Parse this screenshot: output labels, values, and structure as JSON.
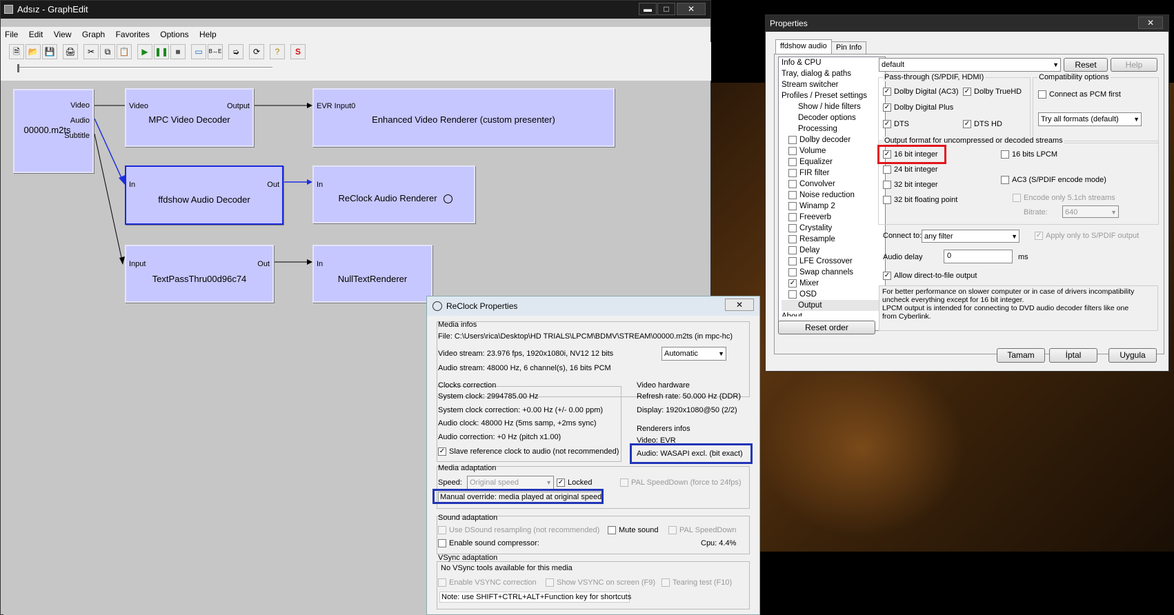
{
  "graphedit": {
    "title": "Adsız - GraphEdit",
    "menu": [
      "File",
      "Edit",
      "View",
      "Graph",
      "Favorites",
      "Options",
      "Help"
    ],
    "filters": {
      "source": {
        "name": "00000.m2ts",
        "pins": [
          "Video",
          "Audio",
          "Subtitle"
        ]
      },
      "mpc": {
        "name": "MPC Video Decoder",
        "in": "Video",
        "out": "Output"
      },
      "evr": {
        "name": "Enhanced Video Renderer (custom presenter)",
        "in": "EVR Input0"
      },
      "ffdshow": {
        "name": "ffdshow Audio Decoder",
        "in": "In",
        "out": "Out"
      },
      "reclock": {
        "name": "ReClock Audio Renderer",
        "in": "In"
      },
      "textpass": {
        "name": "TextPassThru00d96c74",
        "in": "Input",
        "out": "Out"
      },
      "nulltext": {
        "name": "NullTextRenderer",
        "in": "In"
      }
    }
  },
  "props": {
    "title": "Properties",
    "tabs": [
      "ffdshow audio",
      "Pin Info"
    ],
    "tree": [
      "Info & CPU",
      "Tray, dialog & paths",
      "Stream switcher",
      "Profiles / Preset settings",
      "Show / hide filters",
      "Decoder options",
      "Processing",
      "Dolby decoder",
      "Volume",
      "Equalizer",
      "FIR filter",
      "Convolver",
      "Noise reduction",
      "Winamp 2",
      "Freeverb",
      "Crystality",
      "Resample",
      "Delay",
      "LFE Crossover",
      "Swap channels",
      "Mixer",
      "OSD",
      "Output",
      "About"
    ],
    "preset": "default",
    "reset": "Reset",
    "help": "Help",
    "passthrough_title": "Pass-through (S/PDIF, HDMI)",
    "ac3": "Dolby Digital (AC3)",
    "truehd": "Dolby TrueHD",
    "ddplus": "Dolby Digital Plus",
    "dts": "DTS",
    "dtshd": "DTS HD",
    "compat_title": "Compatibility options",
    "pcmfirst": "Connect as PCM first",
    "trymode": "Try all formats (default)",
    "output_title": "Output format for uncompressed or decoded streams",
    "b16": "16 bit integer",
    "b24": "24 bit integer",
    "b32": "32 bit integer",
    "b32f": "32 bit floating point",
    "lpcm16": "16 bits LPCM",
    "ac3enc": "AC3 (S/PDIF encode mode)",
    "enc51": "Encode only 5.1ch streams",
    "bitrate": "Bitrate:",
    "bitrate_val": "640",
    "connect_to": "Connect to:",
    "connect_val": "any filter",
    "spdif_only": "Apply only to S/PDIF output",
    "delay": "Audio delay",
    "delay_val": "0",
    "ms": "ms",
    "direct": "Allow direct-to-file output",
    "info_text": "For better performance on slower computer or in case of drivers incompatibility uncheck everything except for 16 bit integer.\nLPCM output is intended for connecting to DVD audio decoder filters like one from Cyberlink.",
    "reset_order": "Reset order",
    "ok": "Tamam",
    "cancel": "İptal",
    "apply": "Uygula"
  },
  "reclock": {
    "title": "ReClock Properties",
    "media": "Media infos",
    "file": "File:   C:\\Users\\rica\\Desktop\\HD TRIALS\\LPCM\\BDMV\\STREAM\\00000.m2ts (in mpc-hc)",
    "video": "Video stream:  23.976 fps, 1920x1080i, NV12 12 bits",
    "automatic": "Automatic",
    "audio": "Audio stream:  48000 Hz, 6 channel(s), 16 bits PCM",
    "clocks": "Clocks correction",
    "sysclock": "System clock:  2994785.00 Hz",
    "syscorr": "System clock correction:  +0.00 Hz (+/- 0.00 ppm)",
    "audclock": "Audio clock:  48000 Hz (5ms samp, +2ms sync)",
    "audcorr": "Audio correction:  +0 Hz (pitch x1.00)",
    "slave": "Slave reference clock to audio (not recommended)",
    "vhw": "Video hardware",
    "refresh": "Refresh rate:  50.000 Hz (DDR)",
    "display": "Display:  1920x1080@50 (2/2)",
    "renderers": "Renderers infos",
    "vrend": "Video: EVR",
    "arend": "Audio: WASAPI excl. (bit exact)",
    "adapt": "Media adaptation",
    "speed": "Speed:",
    "speed_val": "Original speed",
    "locked": "Locked",
    "pal": "PAL SpeedDown (force to 24fps)",
    "override": "Manual override: media played at original speed",
    "sound": "Sound adaptation",
    "dsound": "Use DSound resampling (not recommended)",
    "mute": "Mute sound",
    "palsd": "PAL SpeedDown",
    "compress": "Enable sound compressor:",
    "cpu": "Cpu:  4.4%",
    "vsync": "VSync adaptation",
    "novsync": "No VSync tools available for this media",
    "vcorr": "Enable VSYNC correction",
    "vscreen": "Show VSYNC on screen (F9)",
    "tear": "Tearing test (F10)",
    "note": "Note: use SHIFT+CTRL+ALT+Function key for shortcuts"
  }
}
